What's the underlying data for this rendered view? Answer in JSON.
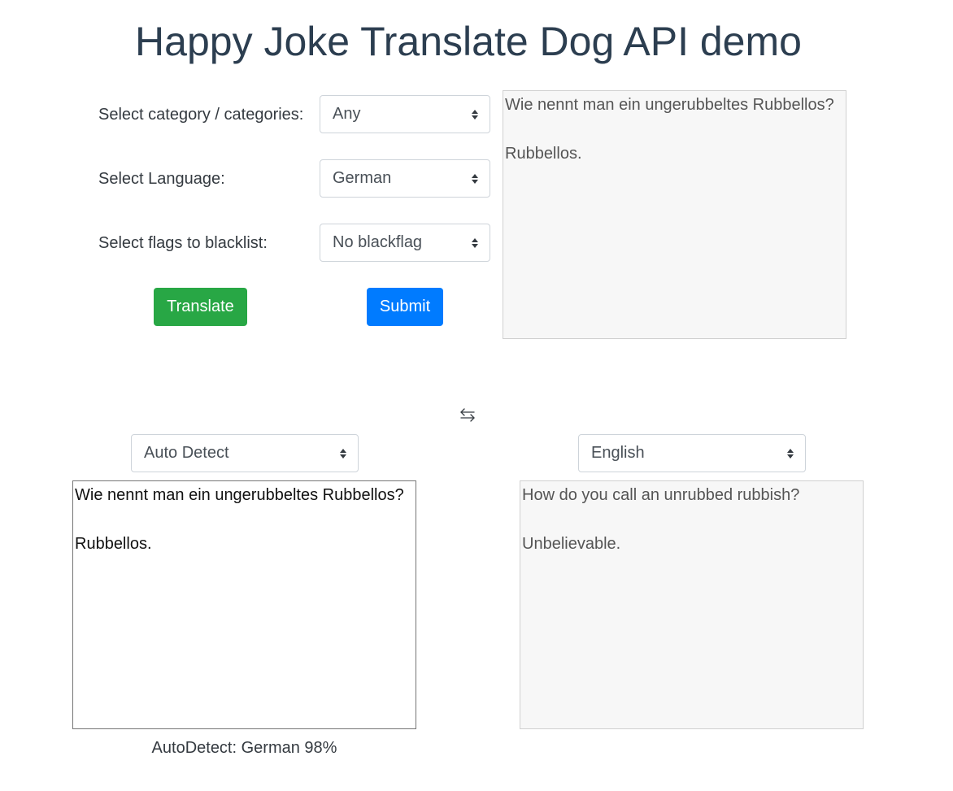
{
  "page": {
    "title": "Happy Joke Translate Dog API demo"
  },
  "form": {
    "category_label": "Select category / categories:",
    "category_value": "Any",
    "language_label": "Select Language:",
    "language_value": "German",
    "blacklist_label": "Select flags to blacklist:",
    "blacklist_value": "No blackflag",
    "translate_label": "Translate",
    "submit_label": "Submit"
  },
  "joke_output": {
    "text": "Wie nennt man ein ungerubbeltes Rubbellos?\n\nRubbellos."
  },
  "translator": {
    "source_lang": "Auto Detect",
    "target_lang": "English",
    "source_text": "Wie nennt man ein ungerubbeltes Rubbellos?\n\nRubbellos.",
    "target_text": "How do you call an unrubbed rubbish?\n\nUnbelievable.",
    "detect_status": "AutoDetect: German 98%",
    "swap_icon": "swap-arrows-icon"
  },
  "colors": {
    "title": "#2c3e50",
    "translate_button": "#28a745",
    "submit_button": "#007bff",
    "readonly_bg": "#f7f7f7"
  }
}
